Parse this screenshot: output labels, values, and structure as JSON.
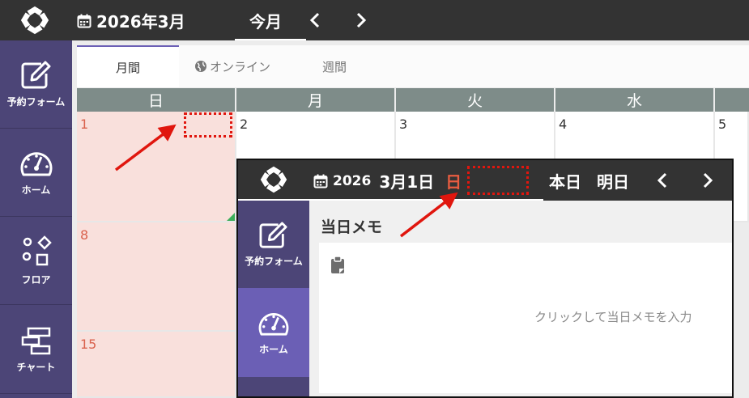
{
  "header": {
    "title": "2026年3月",
    "today_label": "今月",
    "prev_icon": "chevron-left-icon",
    "next_icon": "chevron-right-icon",
    "bg_color": "#333333"
  },
  "sidebar": {
    "bg_color": "#4c4577",
    "items": [
      {
        "label": "予約フォーム",
        "icon": "edit-form-icon"
      },
      {
        "label": "ホーム",
        "icon": "dashboard-gauge-icon"
      },
      {
        "label": "フロア",
        "icon": "floor-shapes-icon"
      },
      {
        "label": "チャート",
        "icon": "gantt-chart-icon"
      }
    ]
  },
  "view_tabs": [
    {
      "label": "月間",
      "active": true
    },
    {
      "label": "オンライン",
      "active": false,
      "icon": "globe-icon"
    },
    {
      "label": "週間",
      "active": false
    }
  ],
  "calendar": {
    "weekdays": [
      "日",
      "月",
      "火",
      "水"
    ],
    "header_color": "#7e8c89",
    "sunday_color": "#f9e0dc",
    "row1_days": [
      "1",
      "2",
      "3",
      "4",
      "5"
    ],
    "sunday_days": [
      "8",
      "15"
    ]
  },
  "overlay": {
    "year": "2026",
    "month_day": "3月1日",
    "weekday": "日",
    "today_label": "本日",
    "tomorrow_label": "明日",
    "sidebar_items": [
      {
        "label": "予約フォーム",
        "icon": "edit-form-icon"
      },
      {
        "label": "ホーム",
        "icon": "dashboard-gauge-icon",
        "active": true
      }
    ],
    "memo_title": "当日メモ",
    "memo_placeholder": "クリックして当日メモを入力",
    "memo_icon": "clipboard-icon"
  },
  "annotation_color": "#e0160e"
}
